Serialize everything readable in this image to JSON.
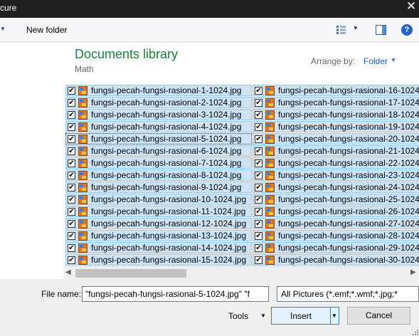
{
  "window": {
    "title": "cure"
  },
  "toolbar": {
    "new_folder_label": "New folder",
    "view_icon": "view-options-icon",
    "pane_icon": "preview-pane-icon",
    "help_label": "?"
  },
  "library": {
    "title": "Documents library",
    "subtitle": "Math",
    "arrange_label": "Arrange by:",
    "arrange_value": "Folder"
  },
  "files": {
    "left": [
      "fungsi-pecah-fungsi-rasional-1-1024.jpg",
      "fungsi-pecah-fungsi-rasional-2-1024.jpg",
      "fungsi-pecah-fungsi-rasional-3-1024.jpg",
      "fungsi-pecah-fungsi-rasional-4-1024.jpg",
      "fungsi-pecah-fungsi-rasional-5-1024.jpg",
      "fungsi-pecah-fungsi-rasional-6-1024.jpg",
      "fungsi-pecah-fungsi-rasional-7-1024.jpg",
      "fungsi-pecah-fungsi-rasional-8-1024.jpg",
      "fungsi-pecah-fungsi-rasional-9-1024.jpg",
      "fungsi-pecah-fungsi-rasional-10-1024.jpg",
      "fungsi-pecah-fungsi-rasional-11-1024.jpg",
      "fungsi-pecah-fungsi-rasional-12-1024.jpg",
      "fungsi-pecah-fungsi-rasional-13-1024.jpg",
      "fungsi-pecah-fungsi-rasional-14-1024.jpg",
      "fungsi-pecah-fungsi-rasional-15-1024.jpg"
    ],
    "right": [
      "fungsi-pecah-fungsi-rasional-16-1024",
      "fungsi-pecah-fungsi-rasional-17-1024",
      "fungsi-pecah-fungsi-rasional-18-1024",
      "fungsi-pecah-fungsi-rasional-19-1024",
      "fungsi-pecah-fungsi-rasional-20-1024",
      "fungsi-pecah-fungsi-rasional-21-1024",
      "fungsi-pecah-fungsi-rasional-22-1024",
      "fungsi-pecah-fungsi-rasional-23-1024",
      "fungsi-pecah-fungsi-rasional-24-1024",
      "fungsi-pecah-fungsi-rasional-25-1024",
      "fungsi-pecah-fungsi-rasional-26-1024",
      "fungsi-pecah-fungsi-rasional-27-1024",
      "fungsi-pecah-fungsi-rasional-28-1024",
      "fungsi-pecah-fungsi-rasional-29-1024",
      "fungsi-pecah-fungsi-rasional-30-1024"
    ],
    "all_checked": true,
    "focused_item": "fungsi-pecah-fungsi-rasional-5-1024.jpg",
    "checkmark": "✔",
    "thumbnail_icon": "image-file-icon"
  },
  "footer": {
    "file_name_label": "File name:",
    "file_name_value": "\"fungsi-pecah-fungsi-rasional-5-1024.jpg\" \"f",
    "file_type_value": "All Pictures (*.emf;*.wmf;*.jpg;*",
    "tools_label": "Tools",
    "insert_label": "Insert",
    "cancel_label": "Cancel"
  },
  "colors": {
    "selection_fill": "#cce4f7",
    "selection_border": "#99c9ef",
    "library_title": "#1e7c3d",
    "link_blue": "#1f5fbf"
  }
}
